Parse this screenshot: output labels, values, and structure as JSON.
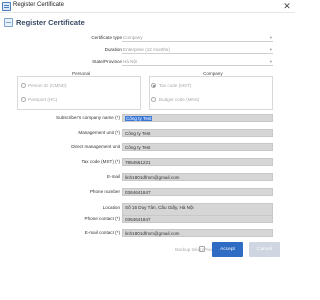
{
  "window": {
    "title": "Register Certificate",
    "close_glyph": "✕"
  },
  "header": {
    "title": "Register Certificate"
  },
  "certificate_type": {
    "label": "Certificate type",
    "value": "Company"
  },
  "duration": {
    "label": "Duration",
    "value": "Enterprise (12 months)"
  },
  "state": {
    "label": "State/Province",
    "value": "Hà Nội"
  },
  "personal": {
    "title": "Personal",
    "options": [
      {
        "label": "Person ID (CMND)",
        "checked": false
      },
      {
        "label": "Passport (HC)",
        "checked": false
      }
    ]
  },
  "company": {
    "title": "Company",
    "options": [
      {
        "label": "Tax code (MST)",
        "checked": true
      },
      {
        "label": "Budget code (MNS)",
        "checked": false
      }
    ]
  },
  "fields": {
    "subscriber_company_name": {
      "label": "Subscriber's company name (*)",
      "value": "Công ty Test"
    },
    "management_unit": {
      "label": "Management unit (*)",
      "value": "Công ty Test"
    },
    "direct_management_unit": {
      "label": "Direct management unit",
      "value": "Công ty Test"
    },
    "tax_code": {
      "label": "Tax code (MST) (*)",
      "value": "7854561221"
    },
    "email": {
      "label": "E-mail",
      "value": "linh1801dfmm@gmail.com"
    },
    "phone": {
      "label": "Phone number",
      "value": "0364641847"
    },
    "location": {
      "label": "Location",
      "value": "Số 15 Duy Tân, Cầu Giấy, Hà Nội"
    },
    "phone_contact": {
      "label": "Phone contact (*)",
      "value": "0364641847"
    },
    "email_contact": {
      "label": "E-mail contact (*)",
      "value": "linh1801dfmm@gmail.com"
    }
  },
  "footer": {
    "backup_label": "Backup token/Pwd",
    "accept_label": "Accept",
    "cancel_label": "Cancel"
  },
  "colors": {
    "accent": "#2f6cc4",
    "field_bg": "#d6d6d6",
    "selection": "#3b78d8"
  }
}
